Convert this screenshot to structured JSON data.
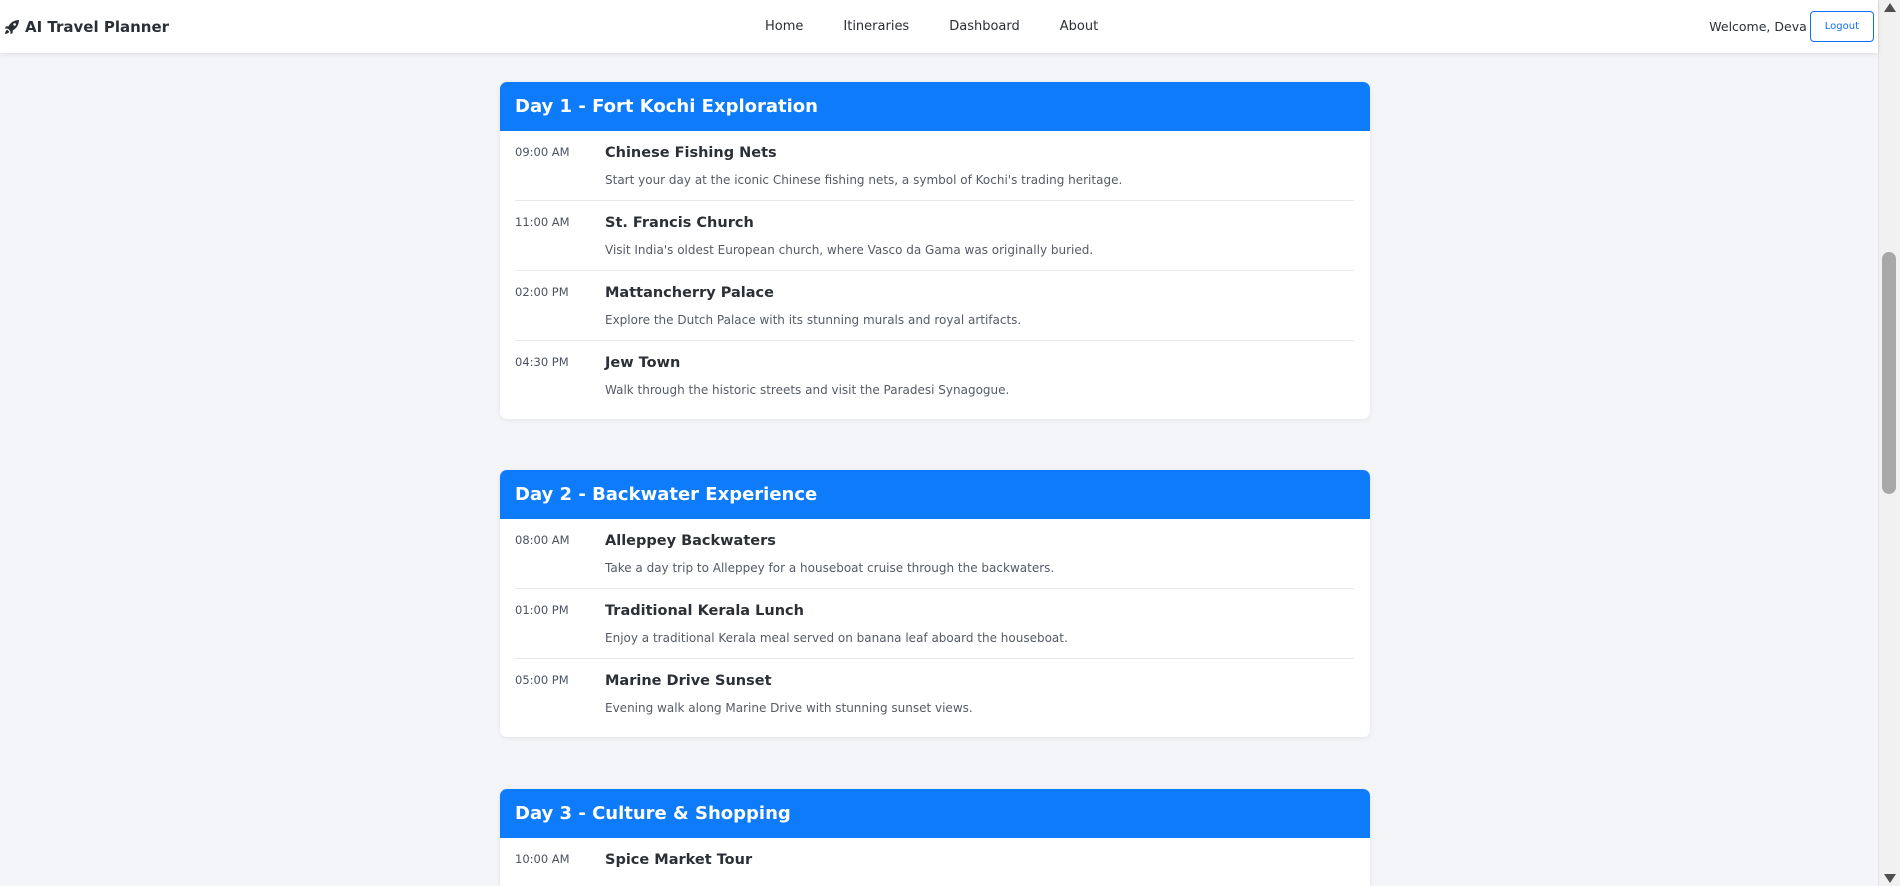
{
  "navbar": {
    "brand_icon": "rocket-icon",
    "brand": "AI Travel Planner",
    "links": [
      "Home",
      "Itineraries",
      "Dashboard",
      "About"
    ],
    "welcome": "Welcome, Deva",
    "logout": "Logout"
  },
  "colors": {
    "accent": "#0d7bfa",
    "card_bg": "#ffffff",
    "page_bg": "#f3f5f9"
  },
  "days": [
    {
      "title": "Day 1 - Fort Kochi Exploration",
      "activities": [
        {
          "time": "09:00 AM",
          "title": "Chinese Fishing Nets",
          "desc": "Start your day at the iconic Chinese fishing nets, a symbol of Kochi's trading heritage."
        },
        {
          "time": "11:00 AM",
          "title": "St. Francis Church",
          "desc": "Visit India's oldest European church, where Vasco da Gama was originally buried."
        },
        {
          "time": "02:00 PM",
          "title": "Mattancherry Palace",
          "desc": "Explore the Dutch Palace with its stunning murals and royal artifacts."
        },
        {
          "time": "04:30 PM",
          "title": "Jew Town",
          "desc": "Walk through the historic streets and visit the Paradesi Synagogue."
        }
      ]
    },
    {
      "title": "Day 2 - Backwater Experience",
      "activities": [
        {
          "time": "08:00 AM",
          "title": "Alleppey Backwaters",
          "desc": "Take a day trip to Alleppey for a houseboat cruise through the backwaters."
        },
        {
          "time": "01:00 PM",
          "title": "Traditional Kerala Lunch",
          "desc": "Enjoy a traditional Kerala meal served on banana leaf aboard the houseboat."
        },
        {
          "time": "05:00 PM",
          "title": "Marine Drive Sunset",
          "desc": "Evening walk along Marine Drive with stunning sunset views."
        }
      ]
    },
    {
      "title": "Day 3 - Culture & Shopping",
      "activities": [
        {
          "time": "10:00 AM",
          "title": "Spice Market Tour",
          "desc": ""
        }
      ]
    }
  ]
}
